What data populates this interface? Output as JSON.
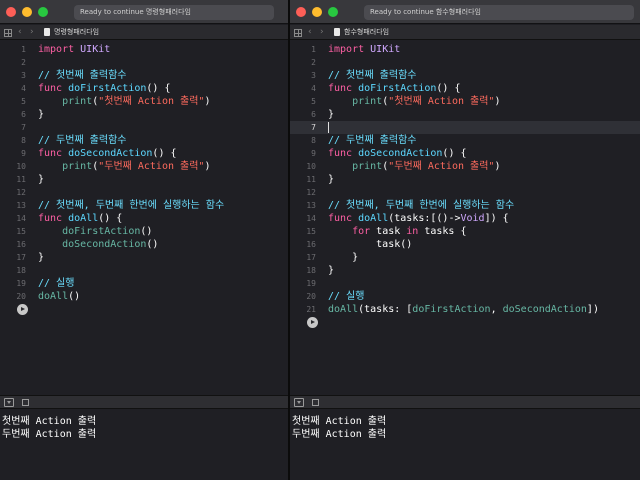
{
  "left_window": {
    "status": "Ready to continue 명령형패러다임",
    "file_name": "명령형패러다임",
    "lines": [
      [
        {
          "t": "import",
          "c": "kw"
        },
        {
          "t": " "
        },
        {
          "t": "UIKit",
          "c": "type"
        }
      ],
      [],
      [
        {
          "t": "// 첫번째 출력함수",
          "c": "cm"
        }
      ],
      [
        {
          "t": "func",
          "c": "kw"
        },
        {
          "t": " "
        },
        {
          "t": "doFirstAction",
          "c": "def"
        },
        {
          "t": "() {"
        }
      ],
      [
        {
          "t": "    "
        },
        {
          "t": "print",
          "c": "call"
        },
        {
          "t": "("
        },
        {
          "t": "\"첫번째 Action 출력\"",
          "c": "str"
        },
        {
          "t": ")"
        }
      ],
      [
        {
          "t": "}"
        }
      ],
      [],
      [
        {
          "t": "// 두번째 출력함수",
          "c": "cm"
        }
      ],
      [
        {
          "t": "func",
          "c": "kw"
        },
        {
          "t": " "
        },
        {
          "t": "doSecondAction",
          "c": "def"
        },
        {
          "t": "() {"
        }
      ],
      [
        {
          "t": "    "
        },
        {
          "t": "print",
          "c": "call"
        },
        {
          "t": "("
        },
        {
          "t": "\"두번째 Action 출력\"",
          "c": "str"
        },
        {
          "t": ")"
        }
      ],
      [
        {
          "t": "}"
        }
      ],
      [],
      [
        {
          "t": "// 첫번째, 두번째 한번에 실행하는 함수",
          "c": "cm"
        }
      ],
      [
        {
          "t": "func",
          "c": "kw"
        },
        {
          "t": " "
        },
        {
          "t": "doAll",
          "c": "def"
        },
        {
          "t": "() {"
        }
      ],
      [
        {
          "t": "    "
        },
        {
          "t": "doFirstAction",
          "c": "call"
        },
        {
          "t": "()"
        }
      ],
      [
        {
          "t": "    "
        },
        {
          "t": "doSecondAction",
          "c": "call"
        },
        {
          "t": "()"
        }
      ],
      [
        {
          "t": "}"
        }
      ],
      [],
      [
        {
          "t": "// 실행",
          "c": "cm"
        }
      ],
      [
        {
          "t": "doAll",
          "c": "call"
        },
        {
          "t": "()"
        }
      ]
    ],
    "console_output": [
      "첫번째 Action 출력",
      "두번째 Action 출력"
    ]
  },
  "right_window": {
    "status": "Ready to continue 함수형패러다임",
    "file_name": "함수형패러다임",
    "current_line": 7,
    "lines": [
      [
        {
          "t": "import",
          "c": "kw"
        },
        {
          "t": " "
        },
        {
          "t": "UIKit",
          "c": "type"
        }
      ],
      [],
      [
        {
          "t": "// 첫번째 출력함수",
          "c": "cm"
        }
      ],
      [
        {
          "t": "func",
          "c": "kw"
        },
        {
          "t": " "
        },
        {
          "t": "doFirstAction",
          "c": "def"
        },
        {
          "t": "() {"
        }
      ],
      [
        {
          "t": "    "
        },
        {
          "t": "print",
          "c": "call"
        },
        {
          "t": "("
        },
        {
          "t": "\"첫번째 Action 출력\"",
          "c": "str"
        },
        {
          "t": ")"
        }
      ],
      [
        {
          "t": "}"
        }
      ],
      [],
      [
        {
          "t": "// 두번째 출력함수",
          "c": "cm"
        }
      ],
      [
        {
          "t": "func",
          "c": "kw"
        },
        {
          "t": " "
        },
        {
          "t": "doSecondAction",
          "c": "def"
        },
        {
          "t": "() {"
        }
      ],
      [
        {
          "t": "    "
        },
        {
          "t": "print",
          "c": "call"
        },
        {
          "t": "("
        },
        {
          "t": "\"두번째 Action 출력\"",
          "c": "str"
        },
        {
          "t": ")"
        }
      ],
      [
        {
          "t": "}"
        }
      ],
      [],
      [
        {
          "t": "// 첫번째, 두번째 한번에 실행하는 함수",
          "c": "cm"
        }
      ],
      [
        {
          "t": "func",
          "c": "kw"
        },
        {
          "t": " "
        },
        {
          "t": "doAll",
          "c": "def"
        },
        {
          "t": "(tasks:[()->"
        },
        {
          "t": "Void",
          "c": "type"
        },
        {
          "t": "]) {"
        }
      ],
      [
        {
          "t": "    "
        },
        {
          "t": "for",
          "c": "kw"
        },
        {
          "t": " task "
        },
        {
          "t": "in",
          "c": "kw"
        },
        {
          "t": " tasks {"
        }
      ],
      [
        {
          "t": "        task()"
        }
      ],
      [
        {
          "t": "    }"
        }
      ],
      [
        {
          "t": "}"
        }
      ],
      [],
      [
        {
          "t": "// 실행",
          "c": "cm"
        }
      ],
      [
        {
          "t": "doAll",
          "c": "call"
        },
        {
          "t": "(tasks: ["
        },
        {
          "t": "doFirstAction",
          "c": "call"
        },
        {
          "t": ", "
        },
        {
          "t": "doSecondAction",
          "c": "call"
        },
        {
          "t": "])"
        }
      ]
    ],
    "console_output": [
      "첫번째 Action 출력",
      "두번째 Action 출력"
    ]
  },
  "colors": {
    "keyword": "#fc5fa3",
    "type": "#d0a8ff",
    "comment": "#6bdfff",
    "string": "#fc6a5d",
    "call": "#67b7a4",
    "definition": "#5dd8ff",
    "background": "#1f1f24"
  },
  "icons": [
    "close-light-icon",
    "minimize-light-icon",
    "zoom-light-icon",
    "grid-icon",
    "chevron-left-icon",
    "chevron-right-icon",
    "swift-file-icon",
    "run-play-icon",
    "hide-debug-area-icon",
    "console-icon"
  ]
}
